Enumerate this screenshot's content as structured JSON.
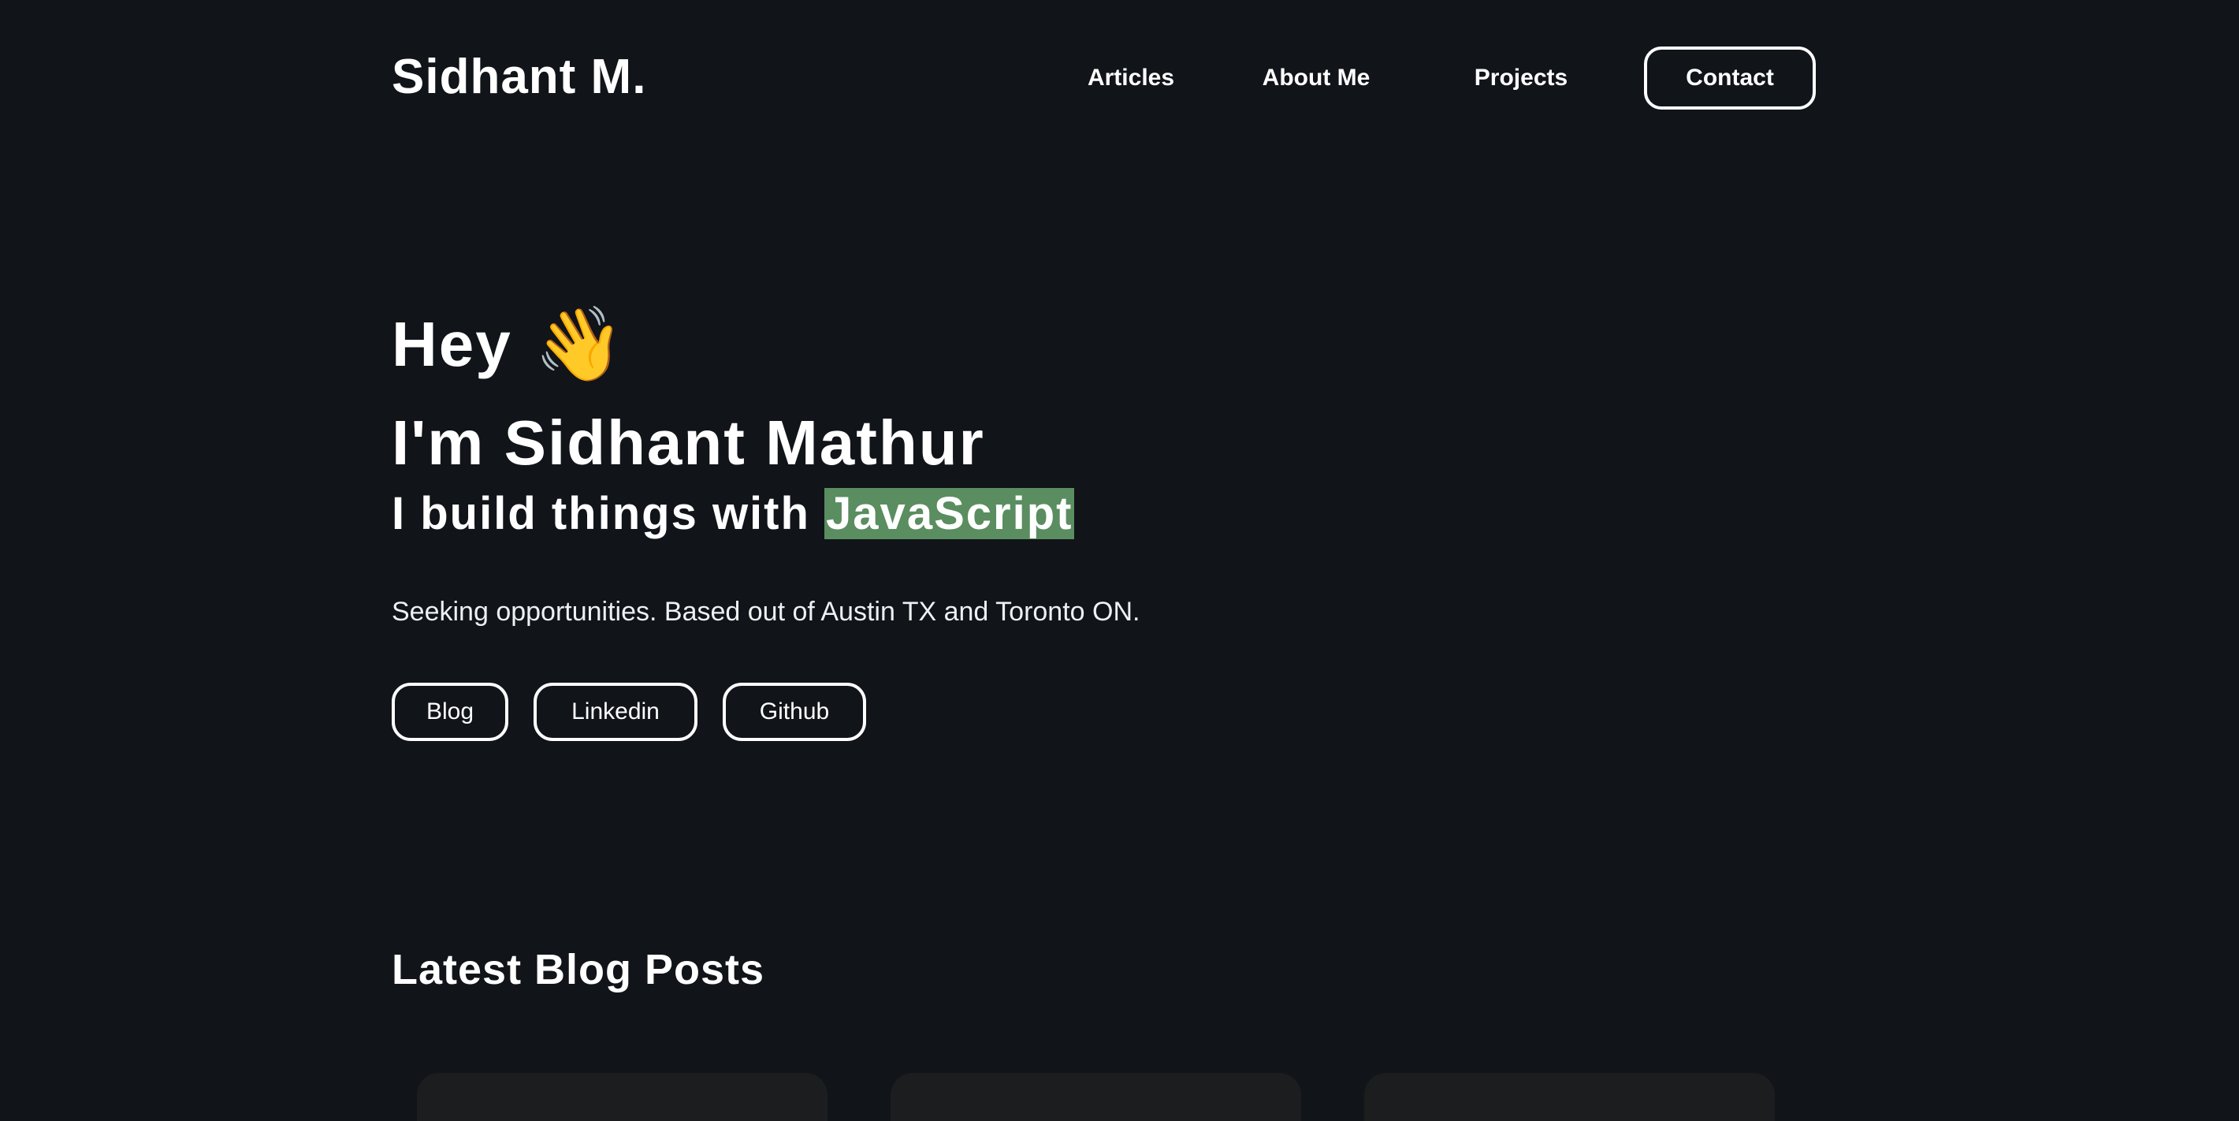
{
  "header": {
    "brand": "Sidhant M.",
    "nav": {
      "articles": "Articles",
      "about": "About Me",
      "projects": "Projects",
      "contact": "Contact"
    }
  },
  "hero": {
    "greeting": "Hey",
    "wave_emoji": "👋",
    "name_line": "I'm Sidhant Mathur",
    "tagline_prefix": "I build things with",
    "tagline_highlight": "JavaScript",
    "description": "Seeking opportunities. Based out of Austin TX and Toronto ON.",
    "links": {
      "blog": "Blog",
      "linkedin": "Linkedin",
      "github": "Github"
    }
  },
  "blog_section": {
    "title": "Latest Blog Posts"
  },
  "colors": {
    "background": "#111419",
    "text": "#ffffff",
    "highlight": "#5a8d5f",
    "card": "#1c1d1f"
  },
  "icons": {
    "wave": "waving-hand-icon"
  }
}
